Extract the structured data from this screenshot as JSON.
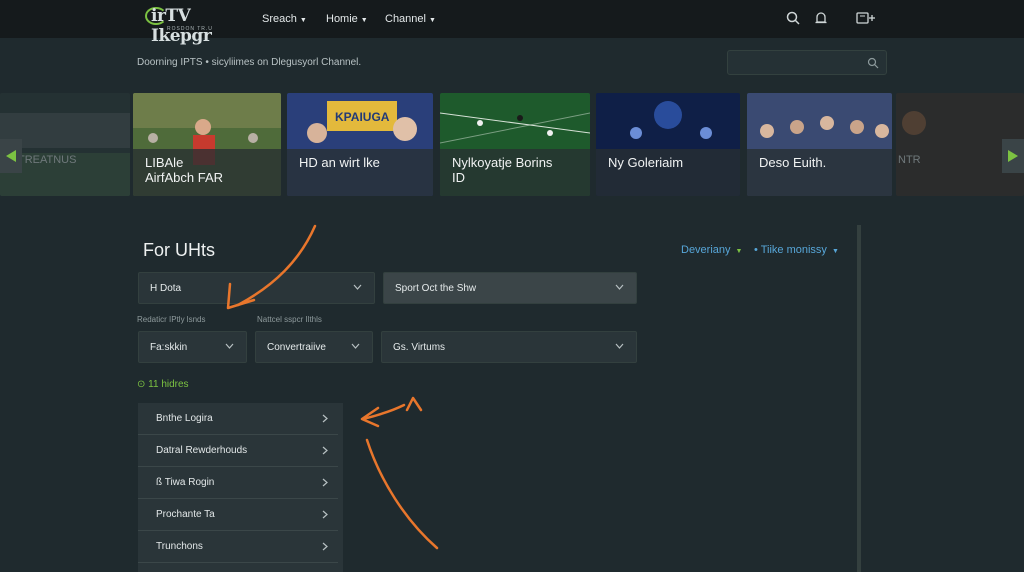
{
  "header": {
    "logo_text": "irTV Ikepgr",
    "logo_sub": "ROSDON TR.U",
    "nav": [
      {
        "label": "Sreach"
      },
      {
        "label": "Homie"
      },
      {
        "label": "Channel"
      }
    ],
    "icons": [
      "search-icon",
      "bell-icon",
      "cast-icon"
    ]
  },
  "tagline": "Doorning IPTS • sicyliimes on Dlegusyorl Channel.",
  "search": {
    "placeholder": ""
  },
  "carousel": {
    "cards": [
      {
        "title": "LIBAle\nAirfAbch FAR"
      },
      {
        "title": "HD an wirt lke"
      },
      {
        "title": "Nylkoyatje Borins\nID"
      },
      {
        "title": "Ny Goleriaim"
      },
      {
        "title": "Deso Euith."
      }
    ],
    "left_edge_text": "TREATNUS",
    "right_edge_text": "NTR",
    "card_banner_text": "KPAIUGA"
  },
  "section": {
    "title": "For UHts",
    "sort_links": [
      {
        "label": "Deveriany"
      },
      {
        "label": "• Tiike monissy"
      }
    ]
  },
  "filters": {
    "row1": [
      {
        "value": "H Dota"
      },
      {
        "value": "Sport Oct the Shw"
      }
    ],
    "labels": [
      "Redaticr IPtly lsnds",
      "Nattcel sspcr Ilthls"
    ],
    "row2": [
      {
        "value": "Fa:skkin"
      },
      {
        "value": "Convertraiive"
      },
      {
        "value": "Gs. Virtums"
      }
    ],
    "count_note": "⊙ 11 hidres"
  },
  "list": {
    "items": [
      {
        "label": "Bnthe Logira"
      },
      {
        "label": "Datral Rewderhouds"
      },
      {
        "label": "ß Tiwa Rogin"
      },
      {
        "label": "Prochante Ta"
      },
      {
        "label": "Trunchons"
      }
    ]
  },
  "colors": {
    "accent_green": "#7cc242",
    "link_blue": "#57a6d8",
    "annotation_orange": "#e8762c"
  }
}
